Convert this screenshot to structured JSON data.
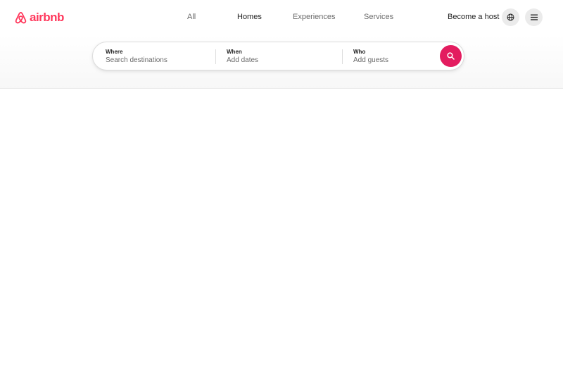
{
  "brand": {
    "name": "airbnb",
    "color": "#ff385c",
    "logo_icon": "airbnb-belo-icon"
  },
  "nav": {
    "tabs": [
      {
        "label": "All",
        "active": false
      },
      {
        "label": "Homes",
        "active": true
      },
      {
        "label": "Experiences",
        "active": false
      },
      {
        "label": "Services",
        "active": false
      }
    ],
    "host_link": "Become a host",
    "globe_icon": "globe-icon",
    "menu_icon": "hamburger-menu-icon"
  },
  "search": {
    "where": {
      "label": "Where",
      "placeholder": "Search destinations"
    },
    "when": {
      "label": "When",
      "placeholder": "Add dates"
    },
    "who": {
      "label": "Who",
      "placeholder": "Add guests"
    },
    "button_icon": "search-icon",
    "button_color": "#e31c5f"
  }
}
